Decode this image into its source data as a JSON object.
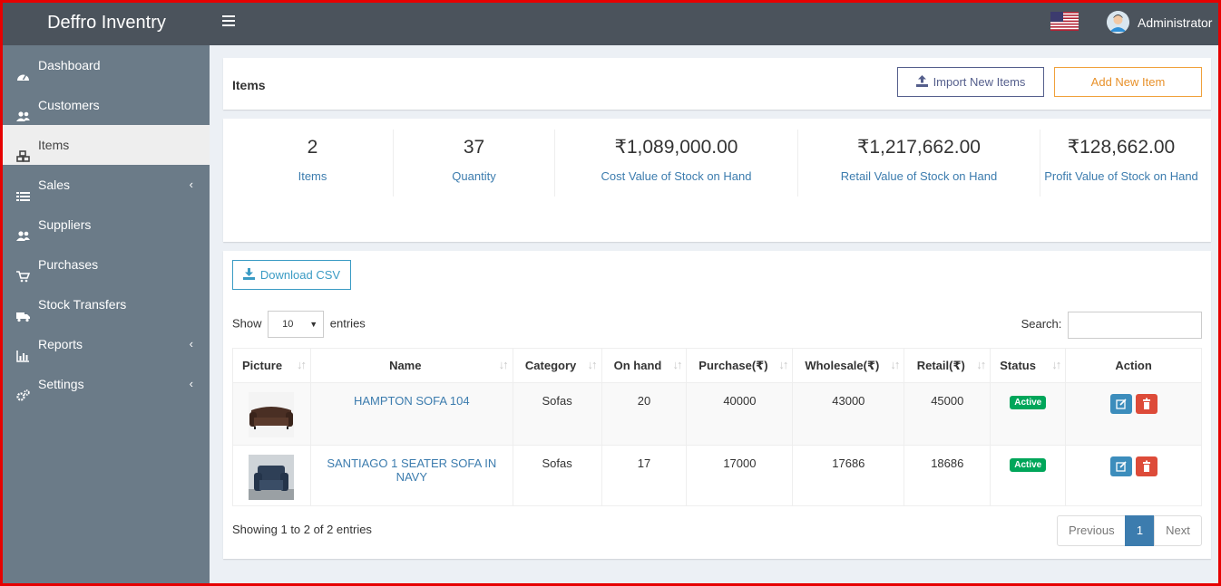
{
  "app": {
    "title": "Deffro Inventry",
    "user": "Administrator"
  },
  "sidebar": {
    "items": [
      {
        "label": "Dashboard",
        "icon": "dashboard-icon"
      },
      {
        "label": "Customers",
        "icon": "users-icon"
      },
      {
        "label": "Items",
        "icon": "cubes-icon",
        "active": true
      },
      {
        "label": "Sales",
        "icon": "list-icon",
        "chevron": "‹"
      },
      {
        "label": "Suppliers",
        "icon": "users-icon"
      },
      {
        "label": "Purchases",
        "icon": "cart-icon"
      },
      {
        "label": "Stock Transfers",
        "icon": "truck-icon"
      },
      {
        "label": "Reports",
        "icon": "bar-chart-icon",
        "chevron": "‹"
      },
      {
        "label": "Settings",
        "icon": "gears-icon",
        "chevron": "‹"
      }
    ]
  },
  "page": {
    "title": "Items",
    "import_label": "Import New Items",
    "add_label": "Add New Item"
  },
  "stats": [
    {
      "value": "2",
      "label": "Items"
    },
    {
      "value": "37",
      "label": "Quantity"
    },
    {
      "value": "₹1,089,000.00",
      "label": "Cost Value of Stock on Hand"
    },
    {
      "value": "₹1,217,662.00",
      "label": "Retail Value of Stock on Hand"
    },
    {
      "value": "₹128,662.00",
      "label": "Profit Value of Stock on Hand"
    }
  ],
  "table": {
    "csv_label": "Download CSV",
    "show_label": "Show",
    "entries_label": "entries",
    "page_size": "10",
    "search_label": "Search:",
    "columns": [
      "Picture",
      "Name",
      "Category",
      "On hand",
      "Purchase(₹)",
      "Wholesale(₹)",
      "Retail(₹)",
      "Status",
      "Action"
    ],
    "rows": [
      {
        "name": "HAMPTON SOFA 104",
        "category": "Sofas",
        "on_hand": "20",
        "purchase": "40000",
        "wholesale": "43000",
        "retail": "45000",
        "status": "Active"
      },
      {
        "name": "SANTIAGO 1 SEATER SOFA IN NAVY",
        "category": "Sofas",
        "on_hand": "17",
        "purchase": "17000",
        "wholesale": "17686",
        "retail": "18686",
        "status": "Active"
      }
    ],
    "showing": "Showing 1 to 2 of 2 entries",
    "pager": {
      "previous": "Previous",
      "current": "1",
      "next": "Next"
    }
  }
}
